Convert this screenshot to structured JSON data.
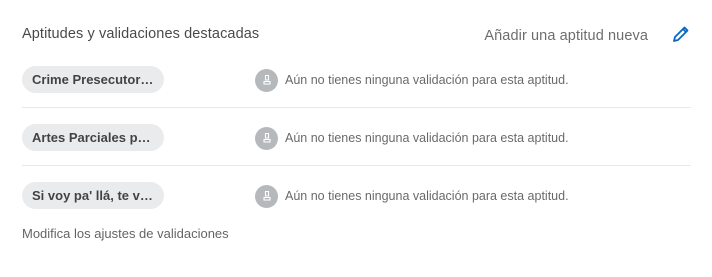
{
  "header": {
    "title": "Aptitudes y validaciones destacadas",
    "add_skill_label": "Añadir una aptitud nueva",
    "edit_icon": "pencil-icon"
  },
  "skills": [
    {
      "label": "Crime Presecutor -...",
      "endorsement_text": "Aún no tienes ninguna validación para esta aptitud."
    },
    {
      "label": "Artes Parciales pa,...",
      "endorsement_text": "Aún no tienes ninguna validación para esta aptitud."
    },
    {
      "label": "Si voy pa' llá, te va...",
      "endorsement_text": "Aún no tienes ninguna validación para esta aptitud."
    }
  ],
  "footer": {
    "settings_link": "Modifica los ajustes de validaciones"
  },
  "colors": {
    "accent": "#0a66c2",
    "pill_bg": "#e9ebed",
    "endorse_icon_bg": "#b6b9bb",
    "divider": "#e6e9ec"
  }
}
